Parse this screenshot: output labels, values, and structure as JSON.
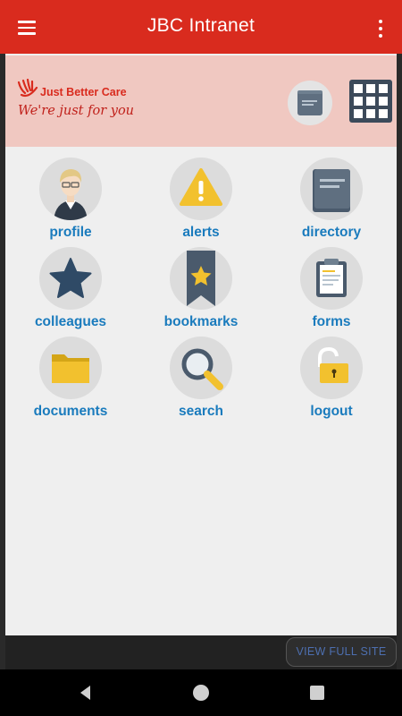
{
  "app_bar": {
    "title": "JBC Intranet",
    "menu_icon": "hamburger-menu-icon",
    "more_icon": "more-vert-icon",
    "color": "#d92b1e"
  },
  "header": {
    "background": "#f0c8c1",
    "logo": {
      "name": "Just Better Care",
      "tagline": "We're just for you"
    },
    "directory_icon": "directory-book-icon",
    "grid_icon": "grid-menu-icon"
  },
  "tiles": [
    {
      "label": "profile",
      "icon": "profile-icon"
    },
    {
      "label": "alerts",
      "icon": "alert-icon"
    },
    {
      "label": "directory",
      "icon": "directory-icon"
    },
    {
      "label": "colleagues",
      "icon": "star-icon"
    },
    {
      "label": "bookmarks",
      "icon": "bookmark-icon"
    },
    {
      "label": "forms",
      "icon": "clipboard-icon"
    },
    {
      "label": "documents",
      "icon": "folder-icon"
    },
    {
      "label": "search",
      "icon": "search-icon"
    },
    {
      "label": "logout",
      "icon": "padlock-icon"
    }
  ],
  "footer": {
    "view_full_site": "VIEW FULL SITE"
  },
  "navbar": {
    "back": "back-icon",
    "home": "home-icon",
    "recents": "recents-icon"
  },
  "colors": {
    "label_blue": "#1a7bbd",
    "content_bg": "#efefef",
    "slate": "#4a5a6c",
    "yellow": "#f2c12e"
  }
}
